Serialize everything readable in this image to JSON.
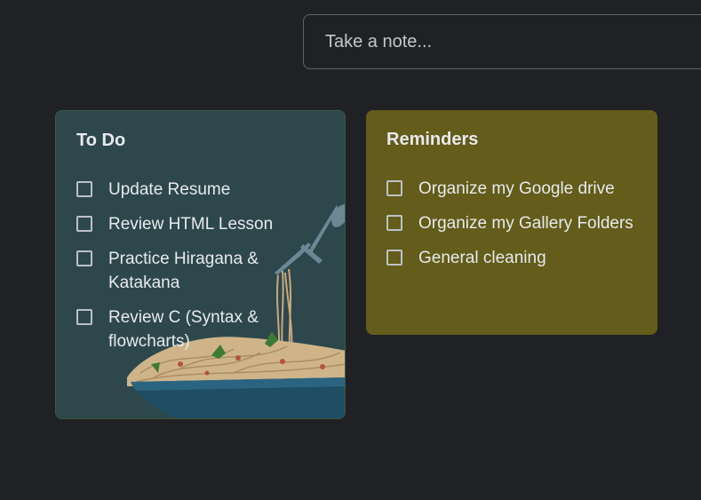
{
  "take_note": {
    "placeholder": "Take a note..."
  },
  "notes": [
    {
      "title": "To Do",
      "color": "#2d474d",
      "background_art": "spaghetti-bowl",
      "items": [
        {
          "label": "Update Resume",
          "checked": false
        },
        {
          "label": "Review HTML Lesson",
          "checked": false
        },
        {
          "label": "Practice Hiragana & Katakana",
          "checked": false
        },
        {
          "label": "Review C (Syntax & flowcharts)",
          "checked": false
        }
      ]
    },
    {
      "title": "Reminders",
      "color": "#635c1a",
      "items": [
        {
          "label": "Organize my Google drive",
          "checked": false
        },
        {
          "label": "Organize my Gallery Folders",
          "checked": false
        },
        {
          "label": "General cleaning",
          "checked": false
        }
      ]
    }
  ]
}
